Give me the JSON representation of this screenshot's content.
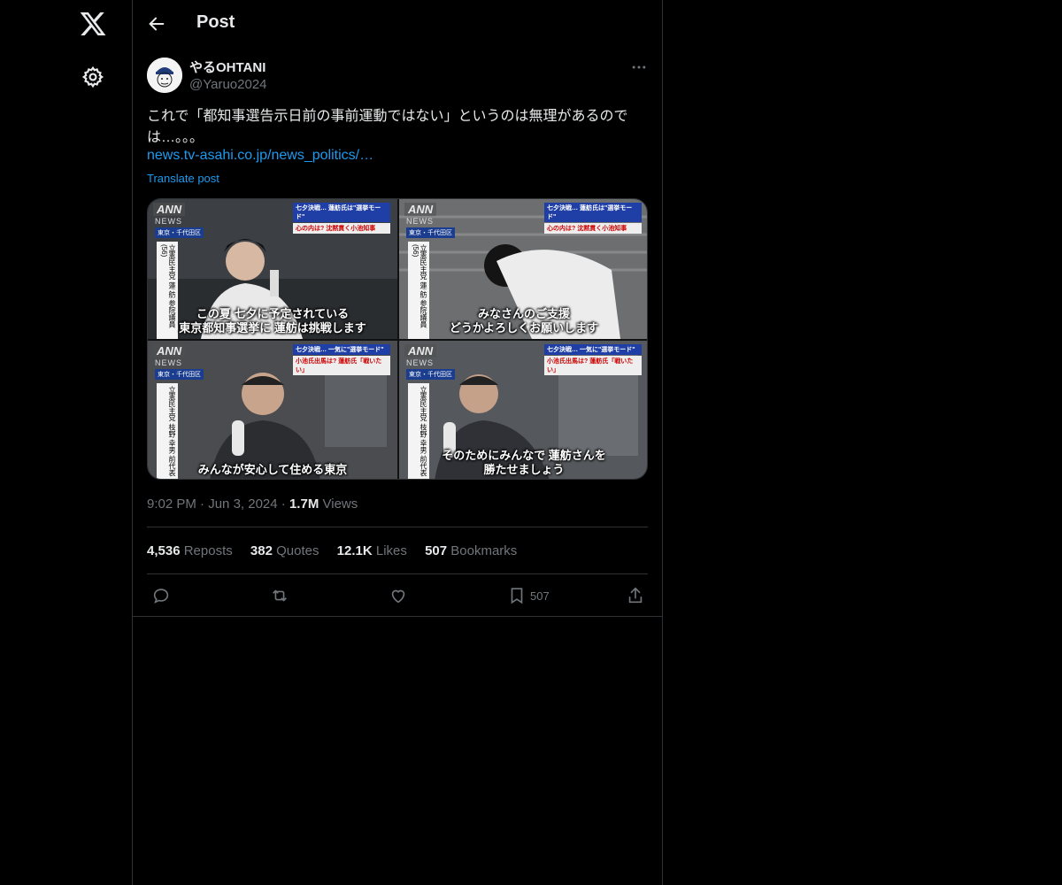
{
  "header": {
    "title": "Post"
  },
  "author": {
    "name": "やるOHTANI",
    "handle": "@Yaruo2024"
  },
  "post": {
    "text": "これで「都知事選告示日前の事前運動ではない」というのは無理があるのでは…。。。",
    "link": "news.tv-asahi.co.jp/news_politics/…",
    "translate": "Translate post"
  },
  "media": {
    "images": [
      {
        "logo": "ANN",
        "news": "NEWS",
        "location": "東京・千代田区",
        "banner1": "七夕決戦… 蓮舫氏は\"選挙モード\"",
        "banner2": "心の内は? 沈黙貫く小池知事",
        "name_vertical": "立憲民主党 蓮 舫 参院議員(56)",
        "subtitle": "この夏 七夕に予定されている\n東京都知事選挙に 蓮舫は挑戦します"
      },
      {
        "logo": "ANN",
        "news": "NEWS",
        "location": "東京・千代田区",
        "banner1": "七夕決戦… 蓮舫氏は\"選挙モード\"",
        "banner2": "心の内は? 沈黙貫く小池知事",
        "name_vertical": "立憲民主党 蓮 舫 参院議員(56)",
        "subtitle": "みなさんのご支援\nどうかよろしくお願いします"
      },
      {
        "logo": "ANN",
        "news": "NEWS",
        "location": "東京・千代田区",
        "banner1": "七夕決戦… 一気に\"選挙モード\"",
        "banner2": "小池氏出馬は? 蓮舫氏「戦いたい」",
        "name_vertical": "立憲民主党 枝野 幸男 前代表",
        "subtitle": "みんなが安心して住める東京"
      },
      {
        "logo": "ANN",
        "news": "NEWS",
        "location": "東京・千代田区",
        "banner1": "七夕決戦… 一気に\"選挙モード\"",
        "banner2": "小池氏出馬は? 蓮舫氏「戦いたい」",
        "name_vertical": "立憲民主党 枝野 幸男 前代表",
        "subtitle": "そのためにみんなで 蓮舫さんを\n勝たせましょう"
      }
    ]
  },
  "meta": {
    "time": "9:02 PM",
    "date": "Jun 3, 2024",
    "views_count": "1.7M",
    "views_label": "Views"
  },
  "stats": {
    "reposts_count": "4,536",
    "reposts_label": "Reposts",
    "quotes_count": "382",
    "quotes_label": "Quotes",
    "likes_count": "12.1K",
    "likes_label": "Likes",
    "bookmarks_count": "507",
    "bookmarks_label": "Bookmarks"
  },
  "actions": {
    "bookmark_count": "507"
  },
  "icons": [
    "x-logo-icon",
    "settings-icon",
    "back-arrow-icon",
    "more-icon",
    "reply-icon",
    "repost-icon",
    "like-icon",
    "bookmark-icon",
    "share-icon"
  ],
  "colors": {
    "background": "#000000",
    "text": "#e7e9ea",
    "muted": "#71767b",
    "accent": "#1d9bf0",
    "border": "#2f3336"
  }
}
